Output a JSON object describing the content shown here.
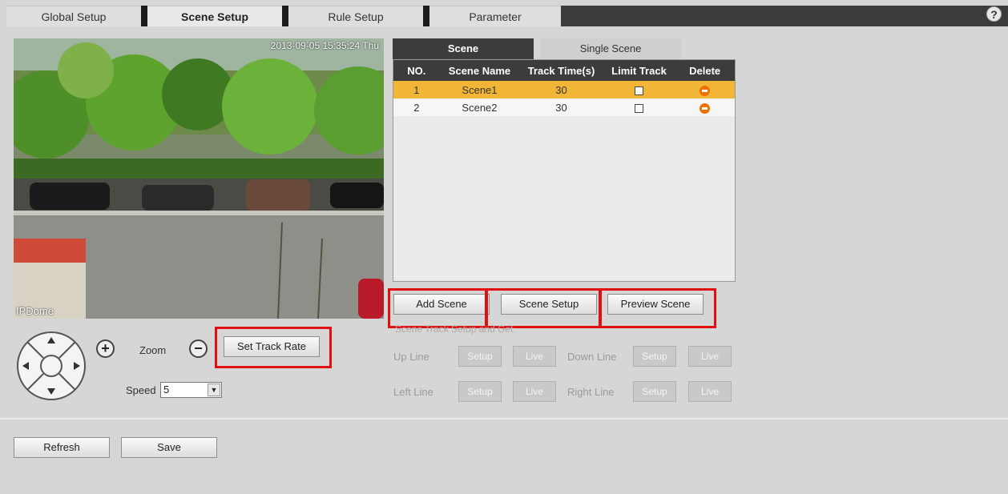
{
  "tabs": [
    {
      "label": "Global Setup",
      "active": false
    },
    {
      "label": "Scene Setup",
      "active": true
    },
    {
      "label": "Rule Setup",
      "active": false
    },
    {
      "label": "Parameter",
      "active": false
    }
  ],
  "help_icon": "?",
  "video": {
    "timestamp": "2013-09-05 15:35:24 Thu",
    "channel_name": "IPDome"
  },
  "ptz": {
    "zoom_label": "Zoom",
    "zoom_in": "+",
    "zoom_out": "−",
    "set_track_rate": "Set Track Rate",
    "speed_label": "Speed",
    "speed_value": "5"
  },
  "scene_tabs": [
    {
      "label": "Scene",
      "active": true
    },
    {
      "label": "Single Scene",
      "active": false
    }
  ],
  "scene_table": {
    "headers": [
      "NO.",
      "Scene Name",
      "Track Time(s)",
      "Limit Track",
      "Delete"
    ],
    "rows": [
      {
        "no": "1",
        "name": "Scene1",
        "track_time": "30",
        "limit_track": false,
        "selected": true
      },
      {
        "no": "2",
        "name": "Scene2",
        "track_time": "30",
        "limit_track": false,
        "selected": false
      }
    ]
  },
  "scene_buttons": {
    "add": "Add Scene",
    "setup": "Scene Setup",
    "preview": "Preview Scene"
  },
  "track_setup": {
    "title": "Scene Track Setup and Get",
    "up_line": "Up Line",
    "down_line": "Down Line",
    "left_line": "Left Line",
    "right_line": "Right Line",
    "setup": "Setup",
    "live": "Live"
  },
  "footer": {
    "refresh": "Refresh",
    "save": "Save"
  },
  "colors": {
    "selected_row": "#f2b636",
    "highlight_box": "#e01010",
    "dark_header": "#3c3c3c",
    "delete_icon": "#f07000"
  }
}
